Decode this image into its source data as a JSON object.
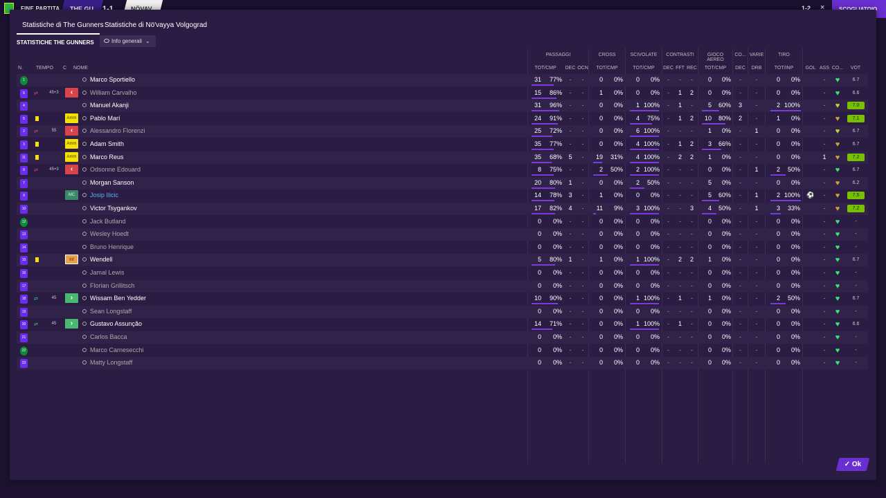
{
  "topbar": {
    "fine": "FINE PARTITA",
    "home": "THE GU",
    "score": "1-1",
    "away": "NÖVAV",
    "rscore": "1-2",
    "close": "×",
    "scg": "SCOGLIATOIO"
  },
  "tabs": [
    "Statistiche di The Gunners",
    "Statistiche di Nö'vayya Volgograd"
  ],
  "section_title": "Statistiche The Gunners",
  "dropdown": "Info generali",
  "groups": {
    "passaggi": "PASSAGGI",
    "cross": "CROSS",
    "scivolate": "SCIVOLATE",
    "contrasti": "CONTRASTI",
    "aereo": "GIOCO AEREO",
    "co": "CO...",
    "varie": "VARIE",
    "tiro": "TIRO"
  },
  "headers": {
    "n": "N.",
    "tempo": "TEMPO",
    "c": "C",
    "nome": "NOME",
    "pass_tc": "TOT/CMP",
    "dec": "DEC",
    "ocn": "OCN",
    "cross_tc": "TOT/CMP",
    "sciv_tc": "TOT/CMP",
    "cdec": "DEC",
    "fft": "FFT",
    "rec": "REC",
    "aer_tc": "TOT/CMP",
    "adec": "DEC",
    "drb": "DRB",
    "tiro_ti": "TOT/INP",
    "gol": "GOL",
    "ass": "ASS",
    "co": "CO...",
    "vot": "VOT"
  },
  "players": [
    {
      "n": "1",
      "shirt": "green",
      "card": "",
      "sub": "",
      "min": "",
      "box": "",
      "name": "Marco Sportiello",
      "dim": false,
      "link": false,
      "pt": "31",
      "pp": "77%",
      "dec": "-",
      "ocn": "-",
      "ct": "0",
      "cp": "0%",
      "st": "0",
      "sp": "0%",
      "cd": "-",
      "fft": "-",
      "rec": "-",
      "at": "0",
      "ap": "0%",
      "ad": "-",
      "drb": "-",
      "tt": "0",
      "tp": "0%",
      "gol": "",
      "ass": "-",
      "cond": "g",
      "vot": "6.7",
      "hi": false
    },
    {
      "n": "6",
      "shirt": "blue",
      "card": "",
      "sub": "out",
      "min": "45+3",
      "box": "red",
      "name": "William Carvalho",
      "dim": true,
      "link": false,
      "pt": "15",
      "pp": "86%",
      "dec": "-",
      "ocn": "-",
      "ct": "1",
      "cp": "0%",
      "st": "0",
      "sp": "0%",
      "cd": "-",
      "fft": "1",
      "rec": "2",
      "at": "0",
      "ap": "0%",
      "ad": "-",
      "drb": "-",
      "tt": "0",
      "tp": "0%",
      "gol": "",
      "ass": "-",
      "cond": "g",
      "vot": "6.6",
      "hi": false
    },
    {
      "n": "4",
      "shirt": "blue",
      "card": "",
      "sub": "",
      "min": "",
      "box": "",
      "name": "Manuel Akanji",
      "dim": false,
      "link": false,
      "pt": "31",
      "pp": "96%",
      "dec": "-",
      "ocn": "-",
      "ct": "0",
      "cp": "0%",
      "st": "1",
      "sp": "100%",
      "cd": "-",
      "fft": "1",
      "rec": "-",
      "at": "5",
      "ap": "60%",
      "ad": "3",
      "drb": "-",
      "tt": "2",
      "tp": "100%",
      "gol": "",
      "ass": "-",
      "cond": "y",
      "vot": "7.0",
      "hi": true
    },
    {
      "n": "5",
      "shirt": "blue",
      "card": "y",
      "sub": "",
      "min": "",
      "box": "amm",
      "name": "Pablo Marí",
      "dim": false,
      "link": false,
      "pt": "24",
      "pp": "91%",
      "dec": "-",
      "ocn": "-",
      "ct": "0",
      "cp": "0%",
      "st": "4",
      "sp": "75%",
      "cd": "-",
      "fft": "1",
      "rec": "2",
      "at": "10",
      "ap": "80%",
      "ad": "2",
      "drb": "-",
      "tt": "1",
      "tp": "0%",
      "gol": "",
      "ass": "-",
      "cond": "o",
      "vot": "7.1",
      "hi": true
    },
    {
      "n": "2",
      "shirt": "blue",
      "card": "",
      "sub": "out",
      "min": "55",
      "box": "red",
      "name": "Alessandro Florenzi",
      "dim": true,
      "link": false,
      "pt": "25",
      "pp": "72%",
      "dec": "-",
      "ocn": "-",
      "ct": "0",
      "cp": "0%",
      "st": "6",
      "sp": "100%",
      "cd": "-",
      "fft": "-",
      "rec": "-",
      "at": "1",
      "ap": "0%",
      "ad": "-",
      "drb": "1",
      "tt": "0",
      "tp": "0%",
      "gol": "",
      "ass": "-",
      "cond": "y",
      "vot": "6.7",
      "hi": false
    },
    {
      "n": "3",
      "shirt": "blue",
      "card": "y",
      "sub": "",
      "min": "",
      "box": "amm",
      "name": "Adam Smith",
      "dim": false,
      "link": false,
      "pt": "35",
      "pp": "77%",
      "dec": "-",
      "ocn": "-",
      "ct": "0",
      "cp": "0%",
      "st": "4",
      "sp": "100%",
      "cd": "-",
      "fft": "1",
      "rec": "2",
      "at": "3",
      "ap": "66%",
      "ad": "-",
      "drb": "-",
      "tt": "0",
      "tp": "0%",
      "gol": "",
      "ass": "-",
      "cond": "o",
      "vot": "6.7",
      "hi": false
    },
    {
      "n": "11",
      "shirt": "blue",
      "card": "y",
      "sub": "",
      "min": "",
      "box": "amm",
      "name": "Marco Reus",
      "dim": false,
      "link": false,
      "pt": "35",
      "pp": "68%",
      "dec": "5",
      "ocn": "-",
      "ct": "19",
      "cp": "31%",
      "st": "4",
      "sp": "100%",
      "cd": "-",
      "fft": "2",
      "rec": "2",
      "at": "1",
      "ap": "0%",
      "ad": "-",
      "drb": "-",
      "tt": "0",
      "tp": "0%",
      "gol": "",
      "ass": "1",
      "cond": "o",
      "vot": "7.2",
      "hi": true
    },
    {
      "n": "8",
      "shirt": "blue",
      "card": "",
      "sub": "out",
      "min": "45+3",
      "box": "red",
      "name": "Odsonne Edouard",
      "dim": true,
      "link": false,
      "pt": "8",
      "pp": "75%",
      "dec": "-",
      "ocn": "-",
      "ct": "2",
      "cp": "50%",
      "st": "2",
      "sp": "100%",
      "cd": "-",
      "fft": "-",
      "rec": "-",
      "at": "0",
      "ap": "0%",
      "ad": "-",
      "drb": "1",
      "tt": "2",
      "tp": "50%",
      "gol": "",
      "ass": "-",
      "cond": "g",
      "vot": "6.7",
      "hi": false
    },
    {
      "n": "7",
      "shirt": "blue",
      "card": "",
      "sub": "",
      "min": "",
      "box": "",
      "name": "Morgan Sanson",
      "dim": false,
      "link": false,
      "pt": "20",
      "pp": "80%",
      "dec": "1",
      "ocn": "-",
      "ct": "0",
      "cp": "0%",
      "st": "2",
      "sp": "50%",
      "cd": "-",
      "fft": "-",
      "rec": "-",
      "at": "5",
      "ap": "0%",
      "ad": "-",
      "drb": "-",
      "tt": "0",
      "tp": "0%",
      "gol": "",
      "ass": "-",
      "cond": "o",
      "vot": "6.2",
      "hi": false
    },
    {
      "n": "9",
      "shirt": "blue",
      "card": "",
      "sub": "",
      "min": "",
      "box": "mc",
      "name": "Josip Ilicic",
      "dim": false,
      "link": true,
      "pt": "14",
      "pp": "78%",
      "dec": "3",
      "ocn": "-",
      "ct": "1",
      "cp": "0%",
      "st": "0",
      "sp": "0%",
      "cd": "-",
      "fft": "-",
      "rec": "-",
      "at": "5",
      "ap": "60%",
      "ad": "-",
      "drb": "1",
      "tt": "2",
      "tp": "100%",
      "gol": "⚽",
      "ass": "-",
      "cond": "o",
      "vot": "7.5",
      "hi": true
    },
    {
      "n": "10",
      "shirt": "blue",
      "card": "",
      "sub": "",
      "min": "",
      "box": "",
      "name": "Victor Tsygankov",
      "dim": false,
      "link": false,
      "pt": "17",
      "pp": "82%",
      "dec": "4",
      "ocn": "-",
      "ct": "11",
      "cp": "9%",
      "st": "3",
      "sp": "100%",
      "cd": "-",
      "fft": "-",
      "rec": "3",
      "at": "4",
      "ap": "50%",
      "ad": "-",
      "drb": "1",
      "tt": "3",
      "tp": "33%",
      "gol": "",
      "ass": "-",
      "cond": "o",
      "vot": "7.2",
      "hi": true
    },
    {
      "n": "12",
      "shirt": "green",
      "card": "",
      "sub": "",
      "min": "",
      "box": "",
      "name": "Jack Butland",
      "dim": true,
      "link": false,
      "pt": "0",
      "pp": "0%",
      "dec": "-",
      "ocn": "-",
      "ct": "0",
      "cp": "0%",
      "st": "0",
      "sp": "0%",
      "cd": "-",
      "fft": "-",
      "rec": "-",
      "at": "0",
      "ap": "0%",
      "ad": "-",
      "drb": "-",
      "tt": "0",
      "tp": "0%",
      "gol": "",
      "ass": "-",
      "cond": "g",
      "vot": "-",
      "hi": false
    },
    {
      "n": "13",
      "shirt": "blue",
      "card": "",
      "sub": "",
      "min": "",
      "box": "",
      "name": "Wesley Hoedt",
      "dim": true,
      "link": false,
      "pt": "0",
      "pp": "0%",
      "dec": "-",
      "ocn": "-",
      "ct": "0",
      "cp": "0%",
      "st": "0",
      "sp": "0%",
      "cd": "-",
      "fft": "-",
      "rec": "-",
      "at": "0",
      "ap": "0%",
      "ad": "-",
      "drb": "-",
      "tt": "0",
      "tp": "0%",
      "gol": "",
      "ass": "-",
      "cond": "g",
      "vot": "-",
      "hi": false
    },
    {
      "n": "14",
      "shirt": "blue",
      "card": "",
      "sub": "",
      "min": "",
      "box": "",
      "name": "Bruno Henrique",
      "dim": true,
      "link": false,
      "pt": "0",
      "pp": "0%",
      "dec": "-",
      "ocn": "-",
      "ct": "0",
      "cp": "0%",
      "st": "0",
      "sp": "0%",
      "cd": "-",
      "fft": "-",
      "rec": "-",
      "at": "0",
      "ap": "0%",
      "ad": "-",
      "drb": "-",
      "tt": "0",
      "tp": "0%",
      "gol": "",
      "ass": "-",
      "cond": "g",
      "vot": "-",
      "hi": false
    },
    {
      "n": "15",
      "shirt": "blue",
      "card": "y",
      "sub": "",
      "min": "",
      "box": "inf",
      "name": "Wendell",
      "dim": false,
      "link": false,
      "pt": "5",
      "pp": "80%",
      "dec": "1",
      "ocn": "-",
      "ct": "1",
      "cp": "0%",
      "st": "1",
      "sp": "100%",
      "cd": "-",
      "fft": "2",
      "rec": "2",
      "at": "1",
      "ap": "0%",
      "ad": "-",
      "drb": "-",
      "tt": "0",
      "tp": "0%",
      "gol": "",
      "ass": "-",
      "cond": "g",
      "vot": "6.7",
      "hi": false
    },
    {
      "n": "16",
      "shirt": "blue",
      "card": "",
      "sub": "",
      "min": "",
      "box": "",
      "name": "Jamal Lewis",
      "dim": true,
      "link": false,
      "pt": "0",
      "pp": "0%",
      "dec": "-",
      "ocn": "-",
      "ct": "0",
      "cp": "0%",
      "st": "0",
      "sp": "0%",
      "cd": "-",
      "fft": "-",
      "rec": "-",
      "at": "0",
      "ap": "0%",
      "ad": "-",
      "drb": "-",
      "tt": "0",
      "tp": "0%",
      "gol": "",
      "ass": "-",
      "cond": "g",
      "vot": "-",
      "hi": false
    },
    {
      "n": "17",
      "shirt": "blue",
      "card": "",
      "sub": "",
      "min": "",
      "box": "",
      "name": "Florian Grillitsch",
      "dim": true,
      "link": false,
      "pt": "0",
      "pp": "0%",
      "dec": "-",
      "ocn": "-",
      "ct": "0",
      "cp": "0%",
      "st": "0",
      "sp": "0%",
      "cd": "-",
      "fft": "-",
      "rec": "-",
      "at": "0",
      "ap": "0%",
      "ad": "-",
      "drb": "-",
      "tt": "0",
      "tp": "0%",
      "gol": "",
      "ass": "-",
      "cond": "g",
      "vot": "-",
      "hi": false
    },
    {
      "n": "18",
      "shirt": "blue",
      "card": "",
      "sub": "in",
      "min": "45",
      "box": "green",
      "name": "Wissam Ben Yedder",
      "dim": false,
      "link": false,
      "pt": "10",
      "pp": "90%",
      "dec": "-",
      "ocn": "-",
      "ct": "0",
      "cp": "0%",
      "st": "1",
      "sp": "100%",
      "cd": "-",
      "fft": "1",
      "rec": "-",
      "at": "1",
      "ap": "0%",
      "ad": "-",
      "drb": "-",
      "tt": "2",
      "tp": "50%",
      "gol": "",
      "ass": "-",
      "cond": "g",
      "vot": "6.7",
      "hi": false
    },
    {
      "n": "19",
      "shirt": "blue",
      "card": "",
      "sub": "",
      "min": "",
      "box": "",
      "name": "Sean Longstaff",
      "dim": true,
      "link": false,
      "pt": "0",
      "pp": "0%",
      "dec": "-",
      "ocn": "-",
      "ct": "0",
      "cp": "0%",
      "st": "0",
      "sp": "0%",
      "cd": "-",
      "fft": "-",
      "rec": "-",
      "at": "0",
      "ap": "0%",
      "ad": "-",
      "drb": "-",
      "tt": "0",
      "tp": "0%",
      "gol": "",
      "ass": "-",
      "cond": "g",
      "vot": "-",
      "hi": false
    },
    {
      "n": "20",
      "shirt": "blue",
      "card": "",
      "sub": "in",
      "min": "45",
      "box": "green",
      "name": "Gustavo Assunção",
      "dim": false,
      "link": false,
      "pt": "14",
      "pp": "71%",
      "dec": "-",
      "ocn": "-",
      "ct": "0",
      "cp": "0%",
      "st": "1",
      "sp": "100%",
      "cd": "-",
      "fft": "1",
      "rec": "-",
      "at": "0",
      "ap": "0%",
      "ad": "-",
      "drb": "-",
      "tt": "0",
      "tp": "0%",
      "gol": "",
      "ass": "-",
      "cond": "g",
      "vot": "6.6",
      "hi": false
    },
    {
      "n": "21",
      "shirt": "blue",
      "card": "",
      "sub": "",
      "min": "",
      "box": "",
      "name": "Carlos Bacca",
      "dim": true,
      "link": false,
      "pt": "0",
      "pp": "0%",
      "dec": "-",
      "ocn": "-",
      "ct": "0",
      "cp": "0%",
      "st": "0",
      "sp": "0%",
      "cd": "-",
      "fft": "-",
      "rec": "-",
      "at": "0",
      "ap": "0%",
      "ad": "-",
      "drb": "-",
      "tt": "0",
      "tp": "0%",
      "gol": "",
      "ass": "-",
      "cond": "g",
      "vot": "-",
      "hi": false
    },
    {
      "n": "22",
      "shirt": "green",
      "card": "",
      "sub": "",
      "min": "",
      "box": "",
      "name": "Marco Carnesecchi",
      "dim": true,
      "link": false,
      "pt": "0",
      "pp": "0%",
      "dec": "-",
      "ocn": "-",
      "ct": "0",
      "cp": "0%",
      "st": "0",
      "sp": "0%",
      "cd": "-",
      "fft": "-",
      "rec": "-",
      "at": "0",
      "ap": "0%",
      "ad": "-",
      "drb": "-",
      "tt": "0",
      "tp": "0%",
      "gol": "",
      "ass": "-",
      "cond": "g",
      "vot": "-",
      "hi": false
    },
    {
      "n": "23",
      "shirt": "blue",
      "card": "",
      "sub": "",
      "min": "",
      "box": "",
      "name": "Matty Longstaff",
      "dim": true,
      "link": false,
      "pt": "0",
      "pp": "0%",
      "dec": "-",
      "ocn": "-",
      "ct": "0",
      "cp": "0%",
      "st": "0",
      "sp": "0%",
      "cd": "-",
      "fft": "-",
      "rec": "-",
      "at": "0",
      "ap": "0%",
      "ad": "-",
      "drb": "-",
      "tt": "0",
      "tp": "0%",
      "gol": "",
      "ass": "-",
      "cond": "g",
      "vot": "-",
      "hi": false
    }
  ],
  "box_labels": {
    "amm": "Amm",
    "inf": "Inf",
    "mc": "MC",
    "red": "‹",
    "green": "›"
  },
  "ok_label": "✓ Ok"
}
